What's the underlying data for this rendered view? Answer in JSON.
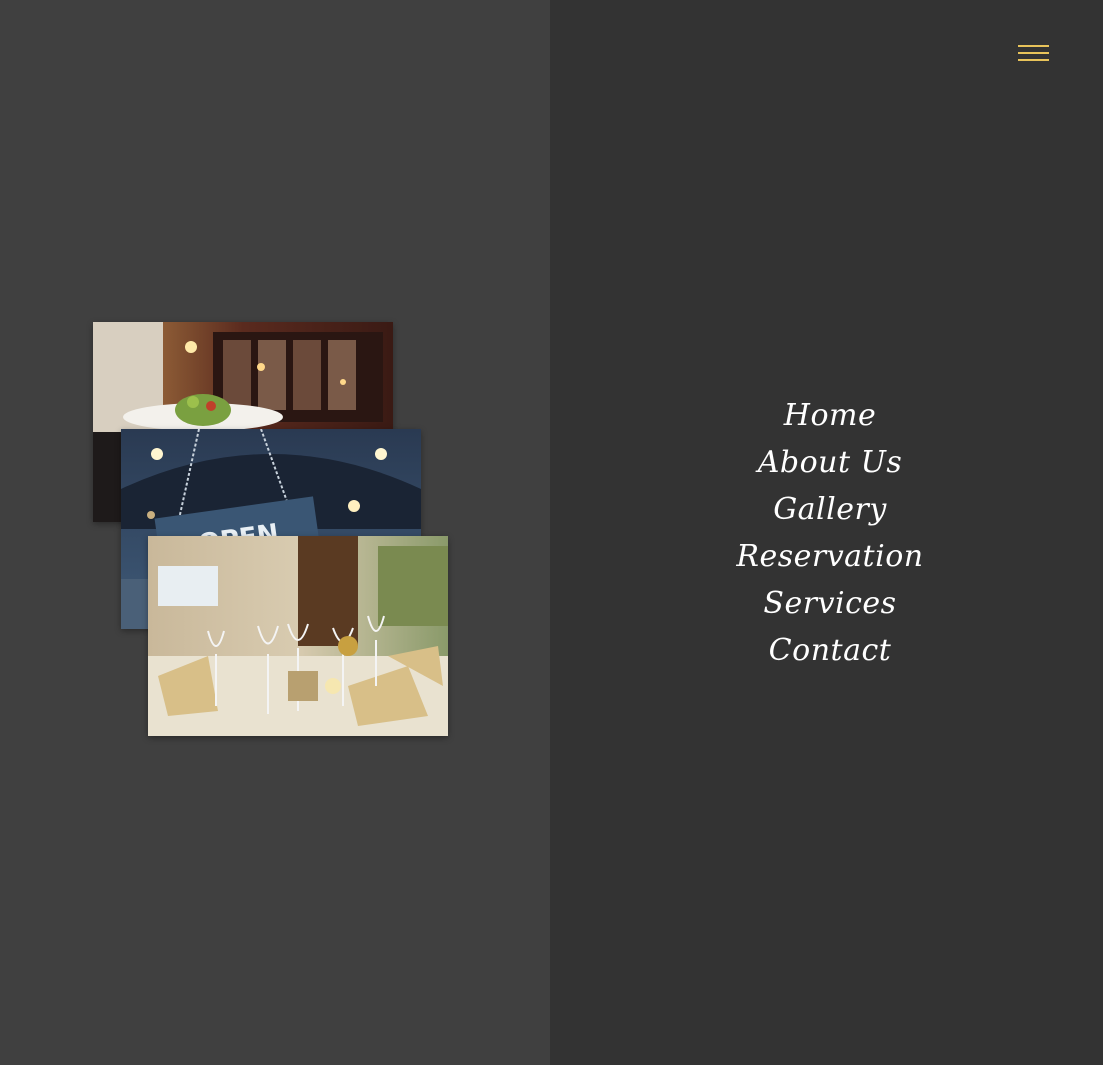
{
  "menu_toggle": {
    "icon": "hamburger-icon",
    "color": "#e8c35a"
  },
  "gallery": {
    "images": [
      {
        "name": "waiter-serving-salad-photo"
      },
      {
        "name": "open-sign-photo",
        "visible_text": "OPEN"
      },
      {
        "name": "restaurant-table-setting-photo"
      }
    ]
  },
  "nav": {
    "items": [
      {
        "label": "Home"
      },
      {
        "label": "About Us"
      },
      {
        "label": "Gallery"
      },
      {
        "label": "Reservation"
      },
      {
        "label": "Services"
      },
      {
        "label": "Contact"
      }
    ]
  },
  "colors": {
    "left_panel": "#404040",
    "right_panel": "#333333",
    "accent": "#e8c35a",
    "nav_text": "#ffffff"
  }
}
